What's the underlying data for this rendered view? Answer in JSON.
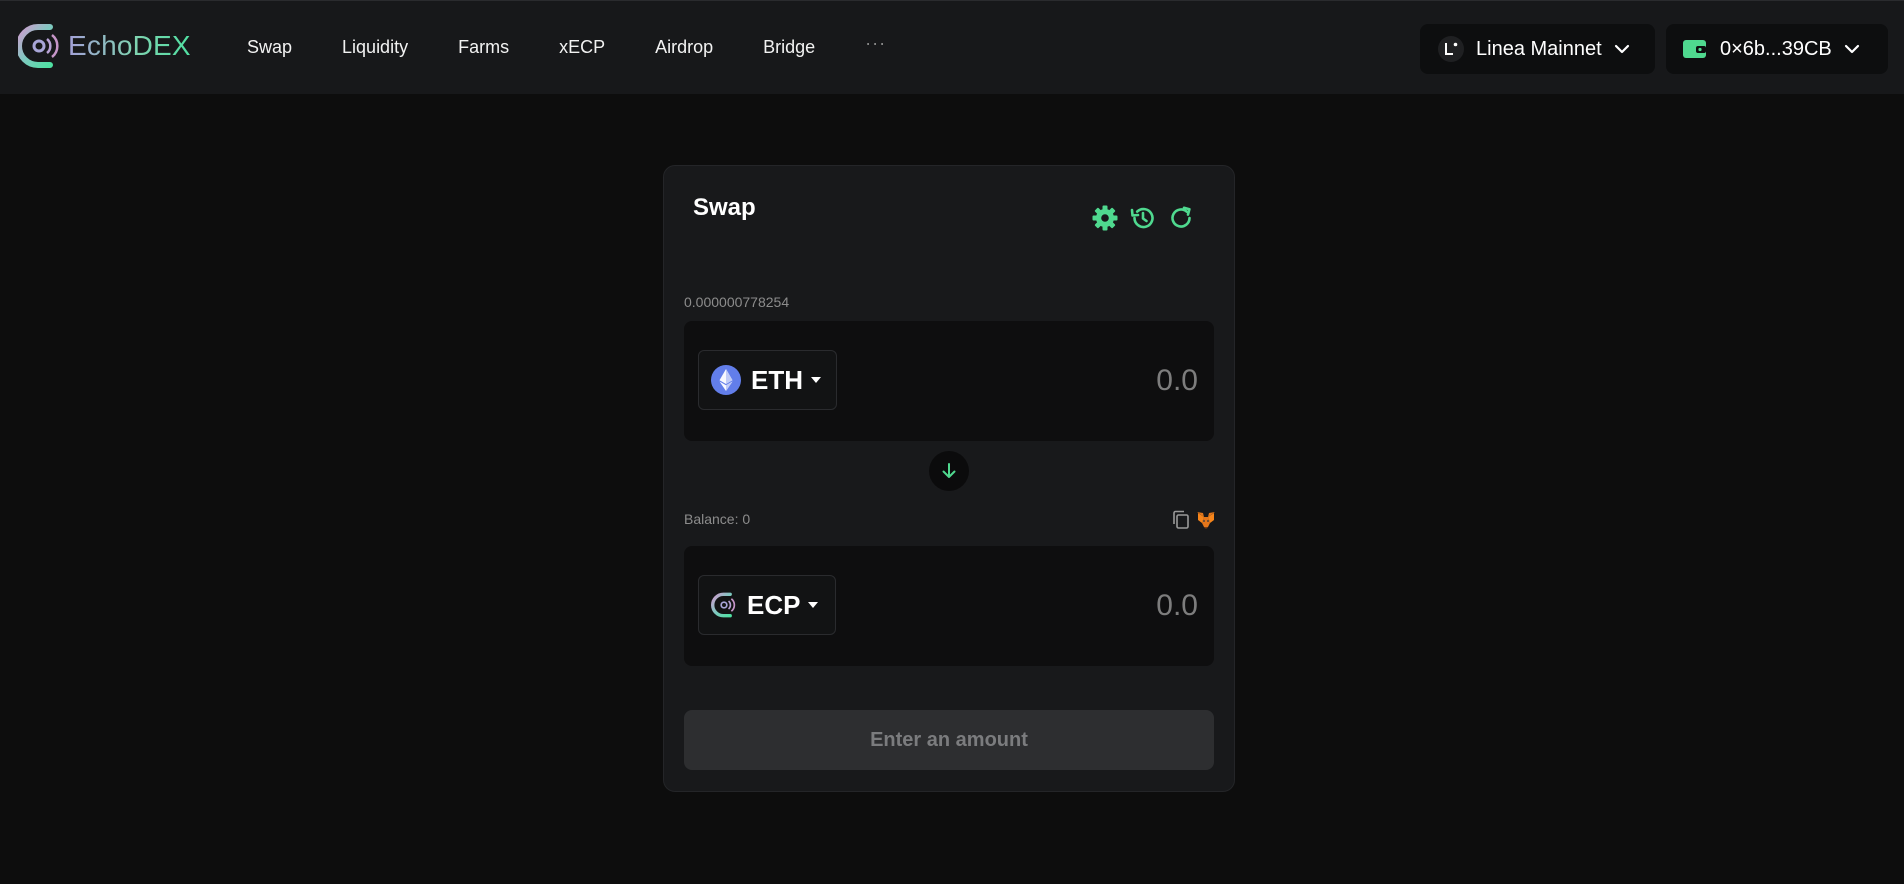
{
  "brand": {
    "name": "EchoDEX",
    "accent": "#4fd98f"
  },
  "nav": {
    "items": [
      "Swap",
      "Liquidity",
      "Farms",
      "xECP",
      "Airdrop",
      "Bridge"
    ],
    "more": "···"
  },
  "network": {
    "label": "Linea Mainnet",
    "icon": "linea-icon"
  },
  "wallet": {
    "address": "0×6b...39CB",
    "icon": "wallet-icon"
  },
  "swap": {
    "title": "Swap",
    "from": {
      "balance_text": "0.000000778254",
      "token": "ETH",
      "amount_placeholder": "0.0",
      "icon": "eth-icon"
    },
    "to": {
      "balance_text": "Balance: 0",
      "token": "ECP",
      "amount_placeholder": "0.0",
      "icon": "ecp-icon"
    },
    "action_label": "Enter an amount"
  }
}
